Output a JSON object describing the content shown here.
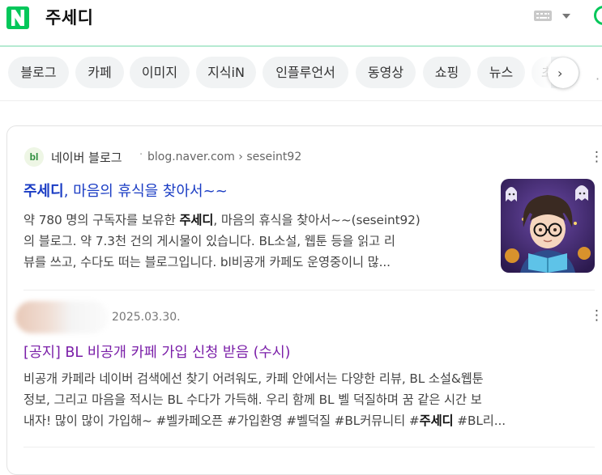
{
  "header": {
    "logo_letter": "N",
    "query": "주세디",
    "brand_color": "#03c75a"
  },
  "tabs": [
    "블로그",
    "카페",
    "이미지",
    "지식iN",
    "인플루언서",
    "동영상",
    "쇼핑",
    "뉴스",
    "초"
  ],
  "tabs_next_glyph": "›",
  "results": [
    {
      "source_icon": "bl",
      "source_name": "네이버 블로그",
      "separator": "·",
      "url": "blog.naver.com › seseint92",
      "title_highlight": "주세디",
      "title_rest": ", 마음의 휴식을 찾아서~~",
      "desc_lines": [
        [
          "약 780 명의 구독자를 보유한 ",
          "주세디",
          ", 마음의 휴식을 찾아서~~(seseint92)"
        ],
        [
          "의 블로그. 약 7.3천 건의 게시물이 있습니다. BL소설, 웹툰 등을 읽고 리"
        ],
        [
          "뷰를 쓰고, 수다도 떠는 블로그입니다. bl비공개 카페도 운영중이니 많..."
        ]
      ]
    },
    {
      "date": "2025.03.30.",
      "title": "[공지] BL 비공개 카페 가입 신청 받음 (수시)",
      "desc_lines": [
        [
          "비공개 카페라 네이버 검색에선 찾기 어려워도, 카페 안에서는 다양한 리뷰, BL 소설&웹툰"
        ],
        [
          "정보, 그리고 마음을 적시는 BL 수다가 가득해. 우리 함께 BL 벨 덕질하며 꿈 같은 시간 보"
        ],
        [
          "내자! 많이 많이 가입해~ #벨카페오픈 #가입환영 #벨덕질 #BL커뮤니티 #",
          "주세디",
          " #BL리..."
        ]
      ]
    }
  ],
  "more_glyph": "⋮",
  "colors": {
    "title_blue": "#1a3cc4",
    "title_purple": "#7a1ea8",
    "divider_green": "#b6ead2"
  }
}
